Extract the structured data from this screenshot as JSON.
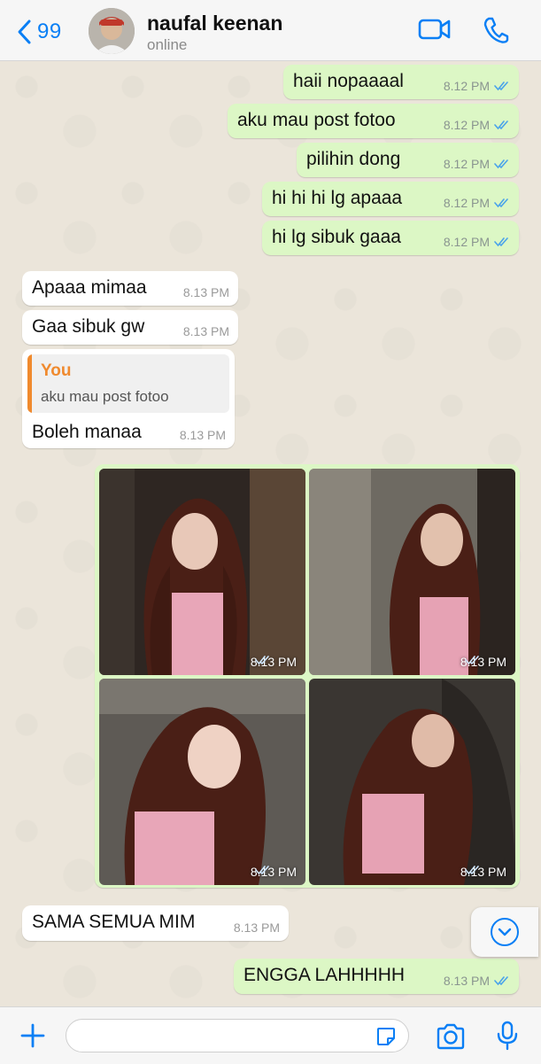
{
  "header": {
    "back_count": "99",
    "contact_name": "naufal keenan",
    "status": "online"
  },
  "messages": [
    {
      "text": "haii nopaaaal",
      "time": "8.12 PM"
    },
    {
      "text": "aku mau post fotoo",
      "time": "8.12 PM"
    },
    {
      "text": "pilihin dong",
      "time": "8.12 PM"
    },
    {
      "text": "hi hi hi lg apaaa",
      "time": "8.12 PM"
    },
    {
      "text": "hi lg sibuk gaaa",
      "time": "8.12 PM"
    },
    {
      "text": "Apaaa mimaa",
      "time": "8.13 PM"
    },
    {
      "text": "Gaa sibuk gw",
      "time": "8.13 PM"
    },
    {
      "text": "Boleh manaa",
      "time": "8.13 PM",
      "quote_author": "You",
      "quote_text": "aku mau post fotoo"
    },
    {
      "text": "SAMA SEMUA MIM",
      "time": "8.13 PM"
    },
    {
      "text": "ENGGA LAHHHHH",
      "time": "8.13 PM"
    }
  ],
  "photos": [
    {
      "time": "8.13 PM"
    },
    {
      "time": "8.13 PM"
    },
    {
      "time": "8.13 PM"
    },
    {
      "time": "8.13 PM"
    }
  ],
  "colors": {
    "accent": "#0a7ff5",
    "outgoing_bubble": "#dcf7c5",
    "incoming_bubble": "#ffffff",
    "quote_author": "#f08a2e",
    "read_ticks": "#4aa3ea"
  },
  "icons": [
    "chevron-left-icon",
    "video-call-icon",
    "phone-icon",
    "double-check-icon",
    "chevron-down-icon",
    "plus-icon",
    "sticker-icon",
    "camera-icon",
    "microphone-icon"
  ]
}
